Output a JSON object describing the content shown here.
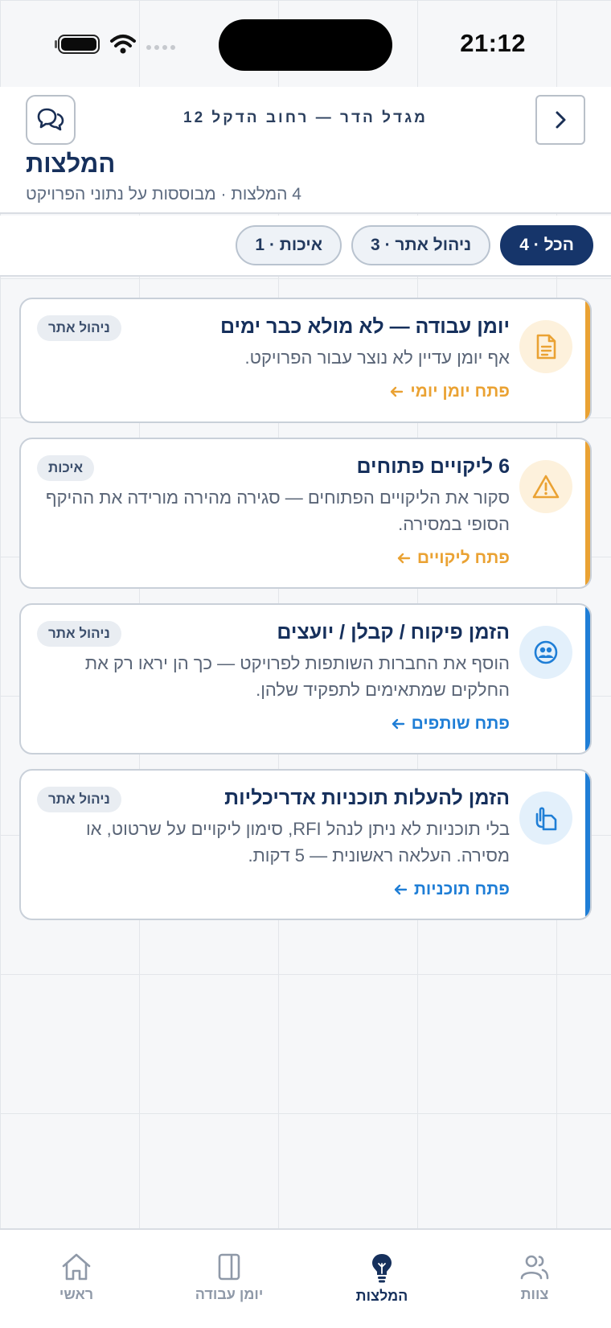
{
  "status_bar": {
    "time": "21:12"
  },
  "header": {
    "project_name": "מגדל הדר — רחוב הדקל 12",
    "title": "המלצות",
    "subtitle": "4 המלצות · מבוססות על נתוני הפרויקט",
    "back_icon": "chevron-right-icon",
    "chat_icon": "chat-bubbles-icon"
  },
  "tabs": [
    {
      "label": "הכל · 4",
      "active": true
    },
    {
      "label": "ניהול אתר · 3",
      "active": false
    },
    {
      "label": "איכות · 1",
      "active": false
    }
  ],
  "cards": [
    {
      "title": "יומן עבודה — לא מולא כבר ימים",
      "description": "אף יומן עדיין לא נוצר עבור הפרויקט.",
      "action": "פתח יומן יומי",
      "tag": "ניהול אתר",
      "icon": "document-icon",
      "accent": "#eaa233"
    },
    {
      "title": "6 ליקויים פתוחים",
      "description": "סקור את הליקויים הפתוחים — סגירה מהירה מורידה את ההיקף הסופי במסירה.",
      "action": "פתח ליקויים",
      "tag": "איכות",
      "icon": "warning-icon",
      "accent": "#eaa233"
    },
    {
      "title": "הזמן פיקוח / קבלן / יועצים",
      "description": "הוסף את החברות השותפות לפרויקט — כך הן יראו רק את החלקים שמתאימים לתפקיד שלהן.",
      "action": "פתח שותפים",
      "tag": "ניהול אתר",
      "icon": "people-icon",
      "accent": "#1f7ed6"
    },
    {
      "title": "הזמן להעלות תוכניות אדריכליות",
      "description": "בלי תוכניות לא ניתן לנהל RFI, סימון ליקויים על שרטוט, או מסירה. העלאה ראשונית — 5 דקות.",
      "action": "פתח תוכניות",
      "tag": "ניהול אתר",
      "icon": "attachment-icon",
      "accent": "#1f7ed6"
    }
  ],
  "bottom_nav": [
    {
      "label": "ראשי",
      "icon": "home-icon",
      "active": false
    },
    {
      "label": "יומן עבודה",
      "icon": "journal-icon",
      "active": false
    },
    {
      "label": "המלצות",
      "icon": "lightbulb-icon",
      "active": true
    },
    {
      "label": "צוות",
      "icon": "team-icon",
      "active": false
    }
  ]
}
